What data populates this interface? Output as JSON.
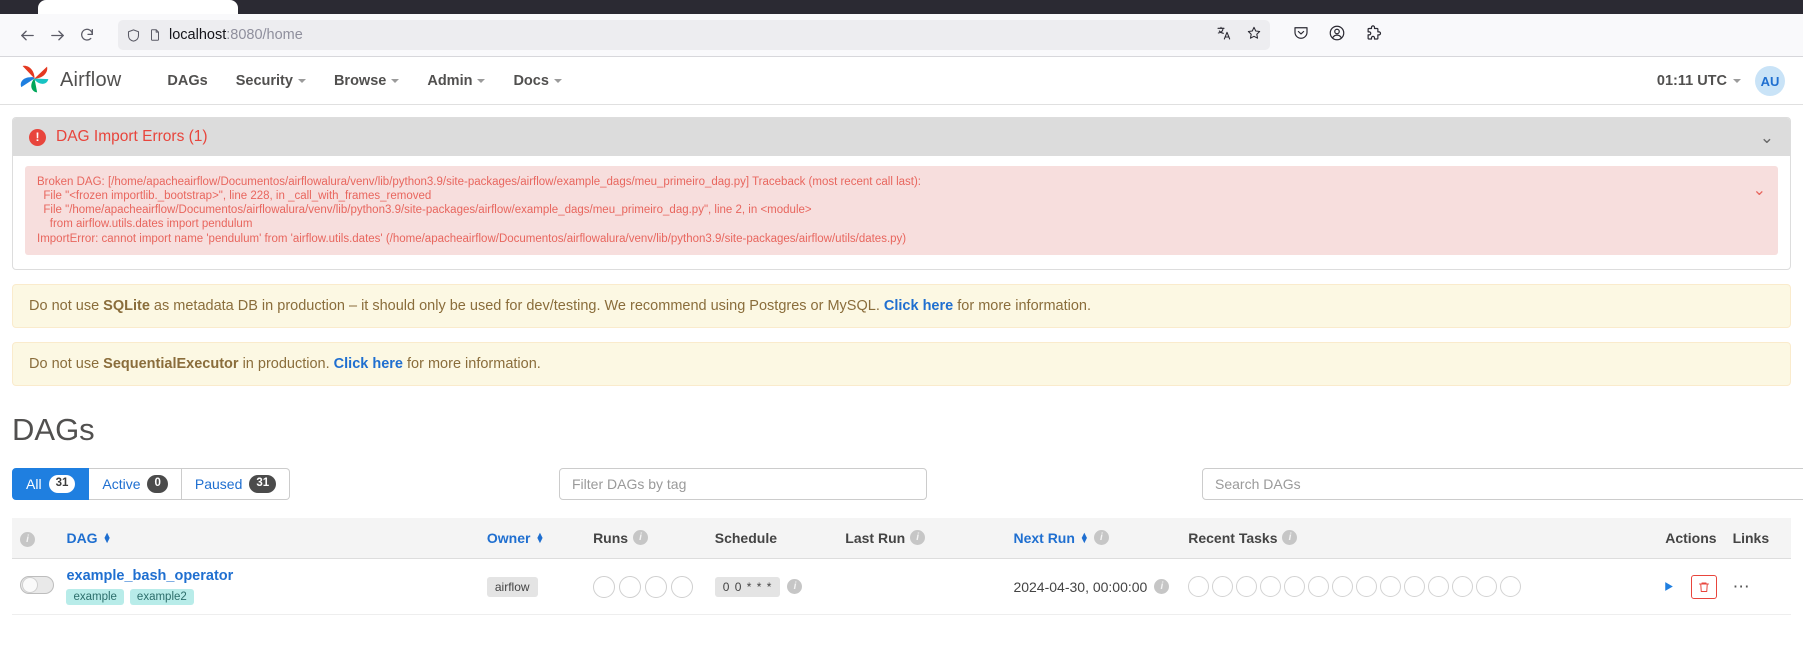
{
  "browser": {
    "url_host": "localhost",
    "url_rest": ":8080/home",
    "back_icon": "back-arrow-icon",
    "forward_icon": "forward-arrow-icon",
    "reload_icon": "reload-icon",
    "shield_icon": "shield-icon",
    "page_icon": "page-icon",
    "translate_icon": "translate-icon",
    "bookmark_icon": "star-icon",
    "pocket_icon": "pocket-icon",
    "account_icon": "account-icon",
    "extensions_icon": "extensions-icon"
  },
  "navbar": {
    "brand": "Airflow",
    "items": [
      {
        "label": "DAGs",
        "has_caret": false
      },
      {
        "label": "Security",
        "has_caret": true
      },
      {
        "label": "Browse",
        "has_caret": true
      },
      {
        "label": "Admin",
        "has_caret": true
      },
      {
        "label": "Docs",
        "has_caret": true
      }
    ],
    "clock": "01:11 UTC",
    "avatar": "AU"
  },
  "import_errors": {
    "title": "DAG Import Errors (1)",
    "error_icon": "!",
    "collapse_icon": "⌄",
    "traceback": "Broken DAG: [/home/apacheairflow/Documentos/airflowalura/venv/lib/python3.9/site-packages/airflow/example_dags/meu_primeiro_dag.py] Traceback (most recent call last):\n  File \"<frozen importlib._bootstrap>\", line 228, in _call_with_frames_removed\n  File \"/home/apacheairflow/Documentos/airflowalura/venv/lib/python3.9/site-packages/airflow/example_dags/meu_primeiro_dag.py\", line 2, in <module>\n    from airflow.utils.dates import pendulum\nImportError: cannot import name 'pendulum' from 'airflow.utils.dates' (/home/apacheairflow/Documentos/airflowalura/venv/lib/python3.9/site-packages/airflow/utils/dates.py)"
  },
  "alerts": [
    {
      "pre": "Do not use ",
      "bold": "SQLite",
      "mid": " as metadata DB in production – it should only be used for dev/testing. We recommend using Postgres or MySQL. ",
      "link": "Click here",
      "post": " for more information."
    },
    {
      "pre": "Do not use ",
      "bold": "SequentialExecutor",
      "mid": " in production. ",
      "link": "Click here",
      "post": " for more information."
    }
  ],
  "page": {
    "title": "DAGs"
  },
  "filters": {
    "pills": [
      {
        "label": "All",
        "count": "31",
        "active": true
      },
      {
        "label": "Active",
        "count": "0",
        "active": false
      },
      {
        "label": "Paused",
        "count": "31",
        "active": false
      }
    ],
    "tag_filter_placeholder": "Filter DAGs by tag",
    "search_placeholder": "Search DAGs"
  },
  "table": {
    "columns": [
      {
        "label": "",
        "icon": "info-icon",
        "sortable": false
      },
      {
        "label": "DAG",
        "sortable": true
      },
      {
        "label": "Owner",
        "sortable": true
      },
      {
        "label": "Runs",
        "icon": "info-icon",
        "sortable": false
      },
      {
        "label": "Schedule",
        "sortable": false
      },
      {
        "label": "Last Run",
        "icon": "info-icon",
        "sortable": false
      },
      {
        "label": "Next Run",
        "icon": "info-icon",
        "sortable": true
      },
      {
        "label": "Recent Tasks",
        "icon": "info-icon",
        "sortable": false
      },
      {
        "label": "Actions",
        "sortable": false
      },
      {
        "label": "Links",
        "sortable": false
      }
    ],
    "rows": [
      {
        "paused": true,
        "name": "example_bash_operator",
        "tags": [
          "example",
          "example2"
        ],
        "owner": "airflow",
        "runs": 4,
        "schedule": "0 0 * * *",
        "last_run": "",
        "next_run": "2024-04-30, 00:00:00",
        "recent_tasks": 14,
        "play_icon": "play-icon",
        "delete_icon": "trash-icon",
        "links_icon": "ellipsis-icon"
      }
    ]
  }
}
